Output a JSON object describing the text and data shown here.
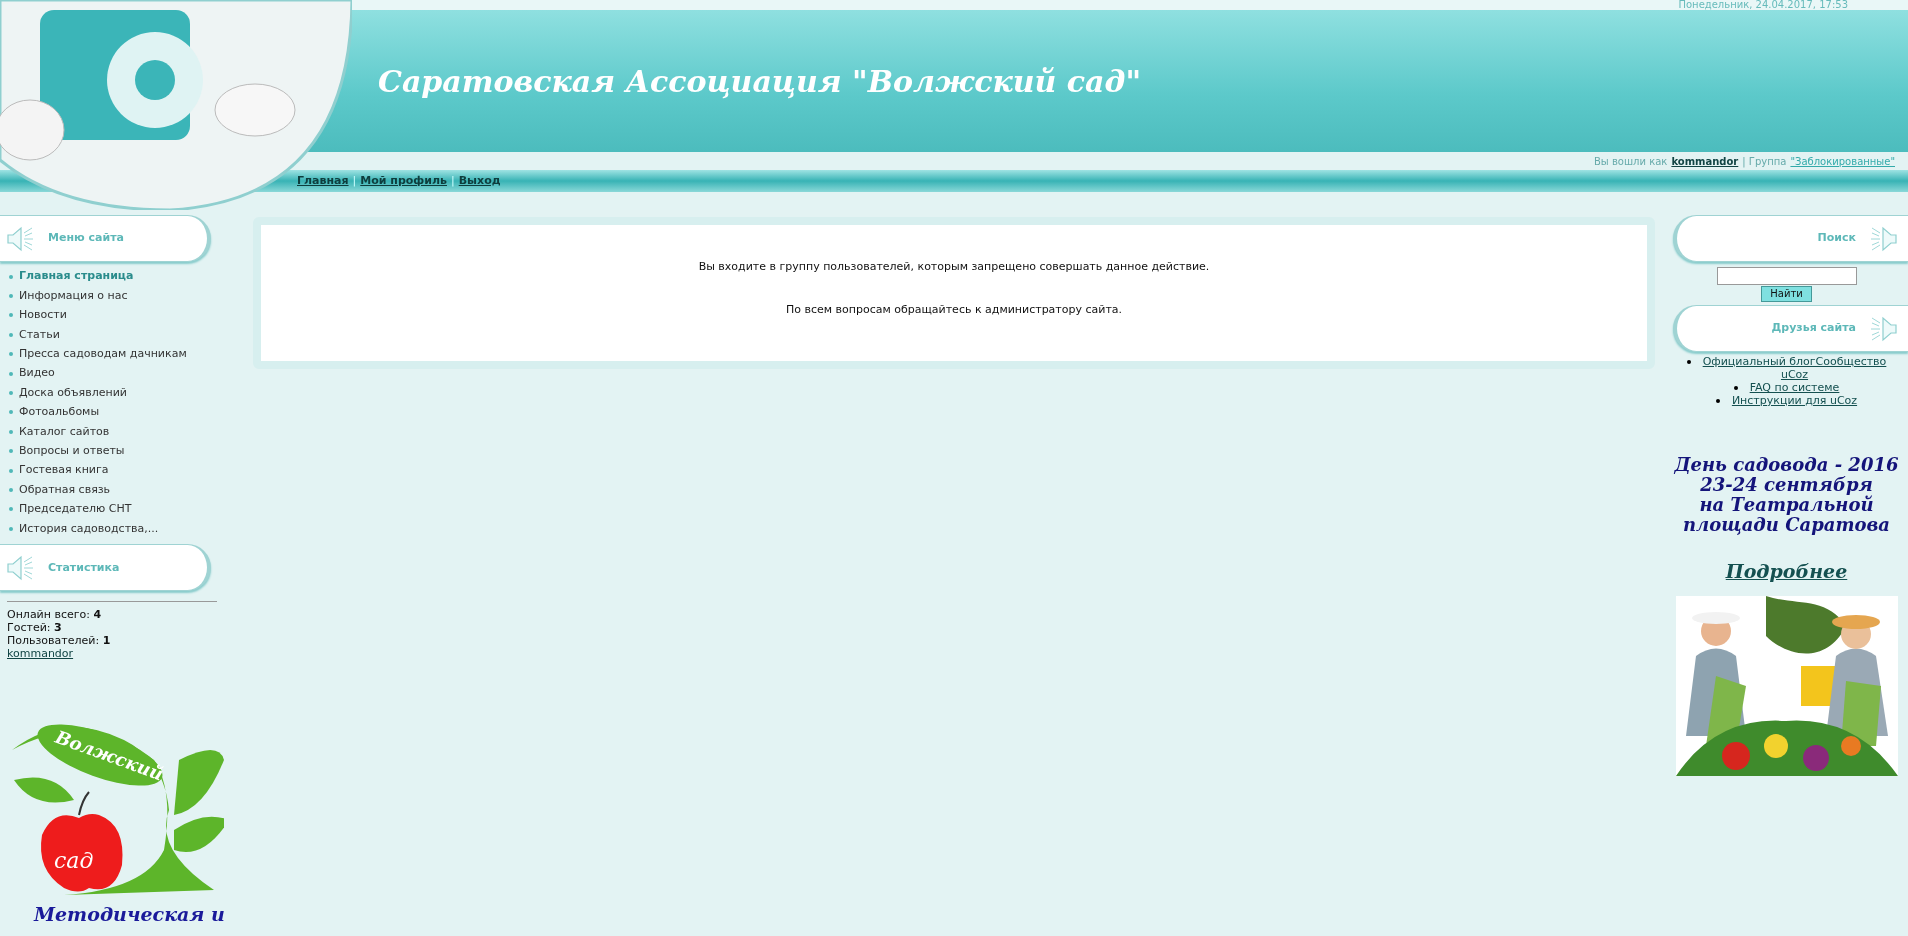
{
  "header": {
    "date": "Понедельник, 24.04.2017, 17:53",
    "title": "Саратовская Ассоциация \"Волжский сад\"",
    "login": {
      "prefix": "Вы вошли как",
      "user": "kommandor",
      "group_prefix": "| Группа",
      "group": "\"Заблокированные\""
    }
  },
  "nav": {
    "separator": "|",
    "links": [
      "Главная",
      "Мой профиль",
      "Выход"
    ]
  },
  "left": {
    "menu": {
      "title": "Меню сайта",
      "items": [
        {
          "label": "Главная страница",
          "selected": true
        },
        {
          "label": "Информация о нас",
          "selected": false
        },
        {
          "label": "Новости",
          "selected": false
        },
        {
          "label": "Статьи",
          "selected": false
        },
        {
          "label": "Пресса садоводам дачникам",
          "selected": false
        },
        {
          "label": "Видео",
          "selected": false
        },
        {
          "label": "Доска объявлений",
          "selected": false
        },
        {
          "label": "Фотоальбомы",
          "selected": false
        },
        {
          "label": "Каталог сайтов",
          "selected": false
        },
        {
          "label": "Вопросы и ответы",
          "selected": false
        },
        {
          "label": "Гостевая книга",
          "selected": false
        },
        {
          "label": "Обратная связь",
          "selected": false
        },
        {
          "label": "Председателю СНТ",
          "selected": false
        },
        {
          "label": "История садоводства,...",
          "selected": false
        }
      ]
    },
    "stats": {
      "title": "Статистика",
      "lines": [
        "Онлайн всего: **4**",
        "Гостей: **3**",
        "Пользователей: **1**"
      ],
      "user": "kommandor"
    },
    "logo": {
      "top": "Волжский",
      "bottom": "сад"
    },
    "caption": "Методическая и"
  },
  "content": {
    "messages": [
      "Вы входите в группу пользователей, которым запрещено совершать данное действие.",
      "По всем вопросам обращайтесь к администратору сайта."
    ]
  },
  "right": {
    "search": {
      "title": "Поиск",
      "button": "Найти"
    },
    "friends": {
      "title": "Друзья сайта",
      "links": [
        "Официальный блогСообщество uCoz",
        "FAQ по системе",
        "Инструкции для uCoz"
      ]
    },
    "promo": {
      "lines": [
        "День садовода - 2016",
        "23-24 сентября",
        "на Театральной",
        "площади Саратова"
      ],
      "more": "Подробнее"
    }
  }
}
